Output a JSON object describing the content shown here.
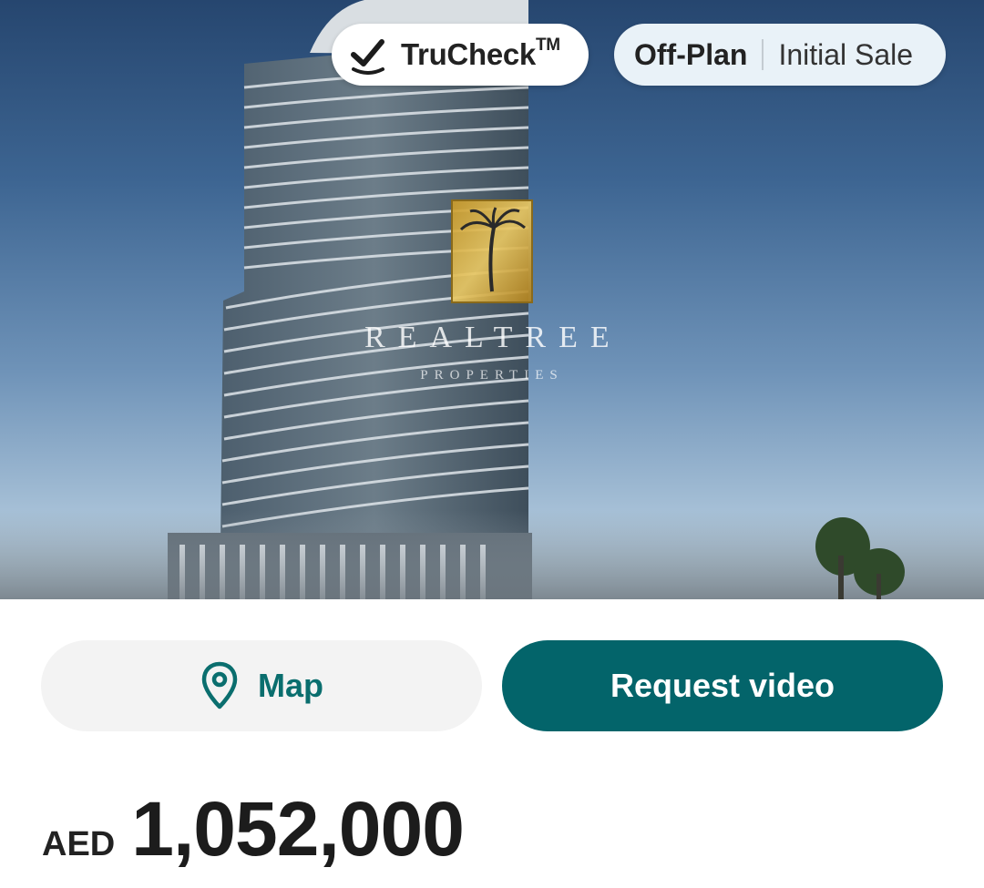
{
  "hero": {
    "image_description_icon": "building-photo",
    "watermark": {
      "brand": "REALTREE",
      "sub": "PROPERTIES"
    },
    "badge_verified": {
      "icon": "check-badge-icon",
      "label": "TruCheck",
      "trademark": "TM"
    },
    "badge_status": {
      "primary": "Off-Plan",
      "secondary": "Initial Sale"
    }
  },
  "actions": {
    "map": {
      "icon": "location-pin-icon",
      "label": "Map"
    },
    "request_video": {
      "label": "Request video"
    }
  },
  "price": {
    "currency": "AED",
    "amount": "1,052,000"
  },
  "colors": {
    "teal": "#03646a",
    "map_text": "#0a6e6e",
    "chip_bg": "#e9f2f8"
  }
}
